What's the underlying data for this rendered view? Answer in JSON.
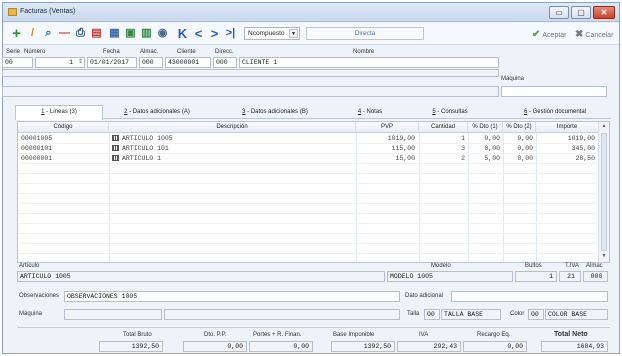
{
  "window": {
    "title": "Facturas (Ventas)"
  },
  "window_controls": {
    "minimize": "▭",
    "maximize": "▢",
    "close": "✕"
  },
  "toolbar": {
    "icons": [
      "add-icon",
      "edit-icon",
      "search-icon",
      "delete-icon",
      "print-icon",
      "print-preview-icon",
      "table-icon",
      "export-icon",
      "export-alt-icon",
      "web-icon",
      "first-icon",
      "prev-icon",
      "next-icon",
      "last-icon"
    ],
    "glyphs": {
      "add": "+",
      "edit": "/",
      "search": "⌕",
      "delete": "—",
      "print": "⎙",
      "print_preview": "▤",
      "table": "▦",
      "export": "▣",
      "export_alt": "▥",
      "web": "◉",
      "first": "K",
      "prev": "<",
      "next": ">",
      "last": ">|"
    },
    "numbering_select": "Ncompuesto",
    "mode": "Directa",
    "accept_label": "Aceptar",
    "cancel_label": "Cancelar",
    "accent": "#3c73c5"
  },
  "header": {
    "labels": {
      "serie": "Serie",
      "numero": "Número",
      "fecha": "Fecha",
      "almac": "Almac.",
      "cliente": "Cliente",
      "direcc": "Direcc.",
      "nombre": "Nombre",
      "maquina": "Máquina"
    },
    "values": {
      "serie": "00",
      "numero": "1",
      "fecha": "01/01/2017",
      "almac": "000",
      "cliente": "43000001",
      "direcc": "000",
      "nombre": "CLIENTE 1"
    }
  },
  "tabs": [
    {
      "key": "1",
      "label": " - Líneas (3)"
    },
    {
      "key": "2",
      "label": " - Datos adicionales (A)"
    },
    {
      "key": "3",
      "label": " - Datos adicionales (B)"
    },
    {
      "key": "4",
      "label": " - Notas"
    },
    {
      "key": "5",
      "label": " - Consultas"
    },
    {
      "key": "6",
      "label": " - Gestión documental"
    }
  ],
  "grid": {
    "columns": [
      "Código",
      "Descripción",
      "PVP",
      "Cantidad",
      "% Dto (1)",
      "% Dto (2)",
      "Importe"
    ],
    "rows": [
      {
        "codigo": "00001005",
        "descripcion": "ARTICULO 1005",
        "pvp": "1019,00",
        "cantidad": "1",
        "dto1": "0,00",
        "dto2": "0,00",
        "importe": "1019,00"
      },
      {
        "codigo": "00000101",
        "descripcion": "ARTICULO 101",
        "pvp": "115,00",
        "cantidad": "3",
        "dto1": "0,00",
        "dto2": "0,00",
        "importe": "345,00"
      },
      {
        "codigo": "00000001",
        "descripcion": "ARTICULO 1",
        "pvp": "15,00",
        "cantidad": "2",
        "dto1": "5,00",
        "dto2": "0,00",
        "importe": "28,50"
      }
    ],
    "scroll": {
      "up": "▲",
      "down": "▼"
    }
  },
  "detail": {
    "labels": {
      "articulo": "Artículo",
      "modelo": "Modelo",
      "bultos": "Bultos",
      "tiva": "T.IVA",
      "almac": "Almac",
      "observaciones": "Observaciones",
      "dato_adicional": "Dato adicional",
      "maquina": "Máquina",
      "talla": "Talla",
      "color": "Color"
    },
    "values": {
      "articulo": "ARTICULO 1005",
      "modelo": "MODELO 1005",
      "bultos": "1",
      "tiva": "21",
      "almac": "000",
      "observaciones": "OBSERVACIONES 1005",
      "talla_code": "00",
      "talla": "TALLA BASE",
      "color_code": "00",
      "color": "COLOR BASE"
    }
  },
  "totals": {
    "labels": {
      "bruto": "Total Bruto",
      "dto_pp": "Dto. P.P.",
      "portes": "Portes + R. Finan.",
      "base": "Base Imponible",
      "iva": "IVA",
      "recargo": "Recargo Eq.",
      "neto": "Total Neto"
    },
    "values": {
      "bruto": "1392,50",
      "dto_pp": "0,00",
      "portes": "0,00",
      "base": "1392,50",
      "iva": "292,43",
      "recargo": "0,00",
      "neto": "1684,93"
    }
  }
}
